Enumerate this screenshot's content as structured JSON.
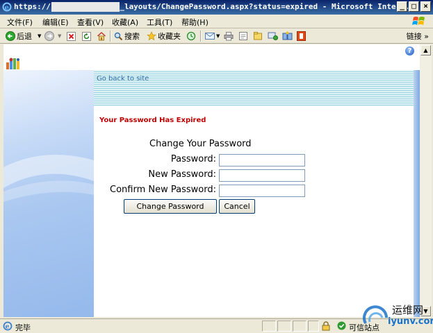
{
  "window": {
    "title": "https://             :/_layouts/ChangePassword.aspx?status=expired - Microsoft Inter..."
  },
  "menubar": {
    "items": [
      "文件(F)",
      "编辑(E)",
      "查看(V)",
      "收藏(A)",
      "工具(T)",
      "帮助(H)"
    ]
  },
  "toolbar": {
    "back_label": "后退",
    "search_label": "搜索",
    "favorites_label": "收藏夹",
    "links_label": "链接"
  },
  "page": {
    "go_back_link": "Go back to site",
    "expired_heading": "Your Password Has Expired",
    "form_title": "Change Your Password",
    "password_label": "Password:",
    "new_password_label": "New Password:",
    "confirm_password_label": "Confirm New Password:",
    "password_value": "",
    "new_password_value": "",
    "confirm_password_value": "",
    "change_button": "Change Password",
    "cancel_button": "Cancel",
    "help_glyph": "?"
  },
  "statusbar": {
    "status_text": "完毕",
    "zone_text": "可信站点"
  },
  "watermark": {
    "line1": "运维网",
    "line2": "iyunv.com"
  },
  "colors": {
    "title_bar": "#0a246a",
    "error_red": "#c00000",
    "link_blue": "#2e6ea8",
    "band_teal": "#9bd3df"
  }
}
